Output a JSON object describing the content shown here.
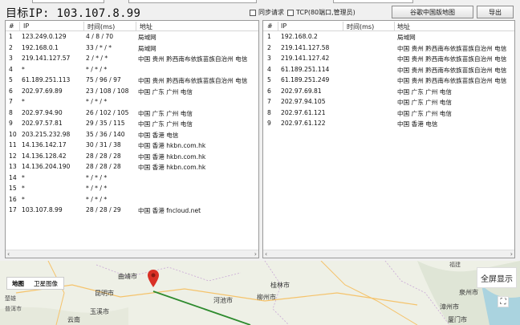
{
  "header": {
    "target_label": "目标IP: 103.107.8.99",
    "sync_label": "同步请求",
    "tcp_label": "TCP(80端口,管理员)",
    "map_button": "谷歌中国版地图",
    "export_button": "导出"
  },
  "left_table": {
    "columns": [
      "#",
      "IP",
      "时间(ms)",
      "地址"
    ],
    "rows": [
      {
        "no": "1",
        "ip": "123.249.0.129",
        "time": "4 / 8 / 70",
        "addr": "局域网"
      },
      {
        "no": "2",
        "ip": "192.168.0.1",
        "time": "33 / * / *",
        "addr": "局域网"
      },
      {
        "no": "3",
        "ip": "219.141.127.57",
        "time": "2 / * / *",
        "addr": "中国 贵州 黔西南布依族苗族自治州 电信"
      },
      {
        "no": "4",
        "ip": "*",
        "time": "* / * / *",
        "addr": ""
      },
      {
        "no": "5",
        "ip": "61.189.251.113",
        "time": "75 / 96 / 97",
        "addr": "中国 贵州 黔西南布依族苗族自治州 电信"
      },
      {
        "no": "6",
        "ip": "202.97.69.89",
        "time": "23 / 108 / 108",
        "addr": "中国 广东 广州 电信"
      },
      {
        "no": "7",
        "ip": "*",
        "time": "* / * / *",
        "addr": ""
      },
      {
        "no": "8",
        "ip": "202.97.94.90",
        "time": "26 / 102 / 105",
        "addr": "中国 广东 广州 电信"
      },
      {
        "no": "9",
        "ip": "202.97.57.81",
        "time": "29 / 35 / 115",
        "addr": "中国 广东 广州 电信"
      },
      {
        "no": "10",
        "ip": "203.215.232.98",
        "time": "35 / 36 / 140",
        "addr": "中国 香港 电信"
      },
      {
        "no": "11",
        "ip": "14.136.142.17",
        "time": "30 / 31 / 38",
        "addr": "中国 香港 hkbn.com.hk"
      },
      {
        "no": "12",
        "ip": "14.136.128.42",
        "time": "28 / 28 / 28",
        "addr": "中国 香港 hkbn.com.hk"
      },
      {
        "no": "13",
        "ip": "14.136.204.190",
        "time": "28 / 28 / 28",
        "addr": "中国 香港 hkbn.com.hk"
      },
      {
        "no": "14",
        "ip": "*",
        "time": "* / * / *",
        "addr": ""
      },
      {
        "no": "15",
        "ip": "*",
        "time": "* / * / *",
        "addr": ""
      },
      {
        "no": "16",
        "ip": "*",
        "time": "* / * / *",
        "addr": ""
      },
      {
        "no": "17",
        "ip": "103.107.8.99",
        "time": "28 / 28 / 29",
        "addr": "中国 香港 fncloud.net"
      }
    ]
  },
  "right_table": {
    "columns": [
      "#",
      "IP",
      "时间(ms)",
      "地址"
    ],
    "rows": [
      {
        "no": "1",
        "ip": "192.168.0.2",
        "addr": "局域网"
      },
      {
        "no": "2",
        "ip": "219.141.127.58",
        "addr": "中国 贵州 黔西南布依族苗族自治州 电信"
      },
      {
        "no": "3",
        "ip": "219.141.127.42",
        "addr": "中国 贵州 黔西南布依族苗族自治州 电信"
      },
      {
        "no": "4",
        "ip": "61.189.251.114",
        "addr": "中国 贵州 黔西南布依族苗族自治州 电信"
      },
      {
        "no": "5",
        "ip": "61.189.251.249",
        "addr": "中国 贵州 黔西南布依族苗族自治州 电信"
      },
      {
        "no": "6",
        "ip": "202.97.69.81",
        "addr": "中国 广东 广州 电信"
      },
      {
        "no": "7",
        "ip": "202.97.94.105",
        "addr": "中国 广东 广州 电信"
      },
      {
        "no": "8",
        "ip": "202.97.61.121",
        "addr": "中国 广东 广州 电信"
      },
      {
        "no": "9",
        "ip": "202.97.61.122",
        "addr": "中国 香港 电信"
      }
    ]
  },
  "map": {
    "tab_map": "地图",
    "tab_satellite": "卫星图像",
    "fullscreen": "全屏显示",
    "labels": [
      "曲靖市",
      "昆明市",
      "玉溪市",
      "云南",
      "河池市",
      "柳州市",
      "桂林市",
      "福建",
      "泉州市",
      "漳州市",
      "厦门市",
      "普洱市",
      "楚雄"
    ]
  },
  "colors": {
    "route_line": "#2e8b2e",
    "marker": "#d93025"
  }
}
